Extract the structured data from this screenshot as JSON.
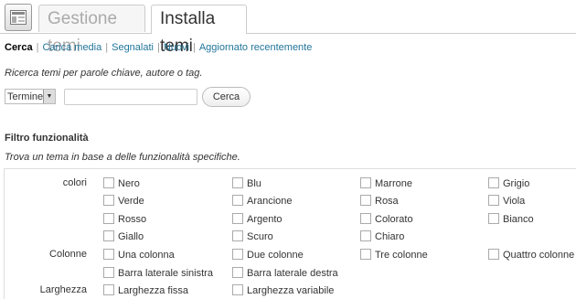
{
  "tabs": {
    "manage": "Gestione temi",
    "install": "Installa temi"
  },
  "subnav": {
    "current": "Cerca",
    "links": [
      "Carica media",
      "Segnalati",
      "Nuovi",
      "Aggiornato recentemente"
    ],
    "separator": "|"
  },
  "search": {
    "description": "Ricerca temi per parole chiave, autore o tag.",
    "select_value": "Termine",
    "input_value": "",
    "button_label": "Cerca"
  },
  "filter": {
    "heading": "Filtro funzionalità",
    "description": "Trova un tema in base a delle funzionalità specifiche.",
    "rows": {
      "colori": "colori",
      "colonne": "Colonne",
      "larghezza": "Larghezza"
    },
    "colors": [
      "Nero",
      "Blu",
      "Marrone",
      "Grigio",
      "Verde",
      "Arancione",
      "Rosa",
      "Viola",
      "Rosso",
      "Argento",
      "Colorato",
      "Bianco",
      "Giallo",
      "Scuro",
      "Chiaro"
    ],
    "columns": [
      "Una colonna",
      "Due colonne",
      "Tre colonne",
      "Quattro colonne",
      "Barra laterale sinistra",
      "Barra laterale destra"
    ],
    "widths": [
      "Larghezza fissa",
      "Larghezza variabile"
    ]
  },
  "colors": {
    "link": "#21759b",
    "border": "#cccccc"
  }
}
